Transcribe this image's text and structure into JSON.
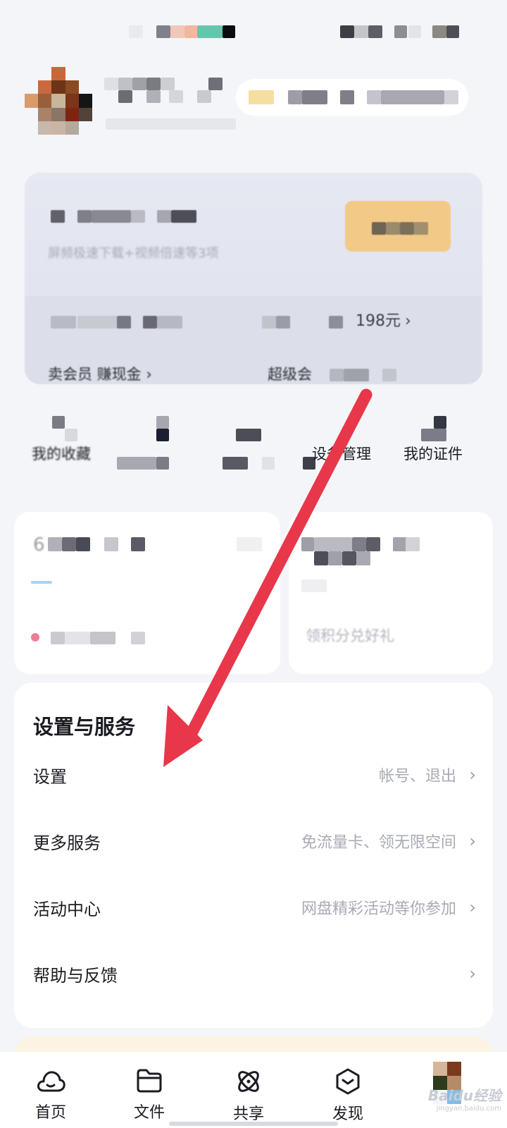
{
  "vip_card": {
    "price_text": "198元",
    "subtitle": "屏频极速下载+视频倍速等3项",
    "earn_link": "卖会员 赚现金",
    "super_label": "超级会"
  },
  "quick_tools": [
    {
      "label": "我的收藏"
    },
    {
      "label": "设备管理"
    },
    {
      "label": "我的证件"
    }
  ],
  "stats": {
    "left_value": "6",
    "right_hint": "领积分兑好礼"
  },
  "settings": {
    "title": "设置与服务",
    "rows": [
      {
        "label": "设置",
        "hint": "帐号、退出"
      },
      {
        "label": "更多服务",
        "hint": "免流量卡、领无限空间"
      },
      {
        "label": "活动中心",
        "hint": "网盘精彩活动等你参加"
      },
      {
        "label": "帮助与反馈",
        "hint": ""
      }
    ]
  },
  "tabbar": {
    "tabs": [
      {
        "label": "首页",
        "icon": "cloud-icon"
      },
      {
        "label": "文件",
        "icon": "folder-icon"
      },
      {
        "label": "共享",
        "icon": "atom-icon"
      },
      {
        "label": "发现",
        "icon": "discover-icon"
      }
    ]
  },
  "colors": {
    "annotation_arrow": "#e8374a",
    "vip_gold": "#f2c987",
    "background": "#f4f5f8"
  },
  "watermark": {
    "brand": "Baidu经验",
    "url": "jingyan.baidu.com"
  }
}
